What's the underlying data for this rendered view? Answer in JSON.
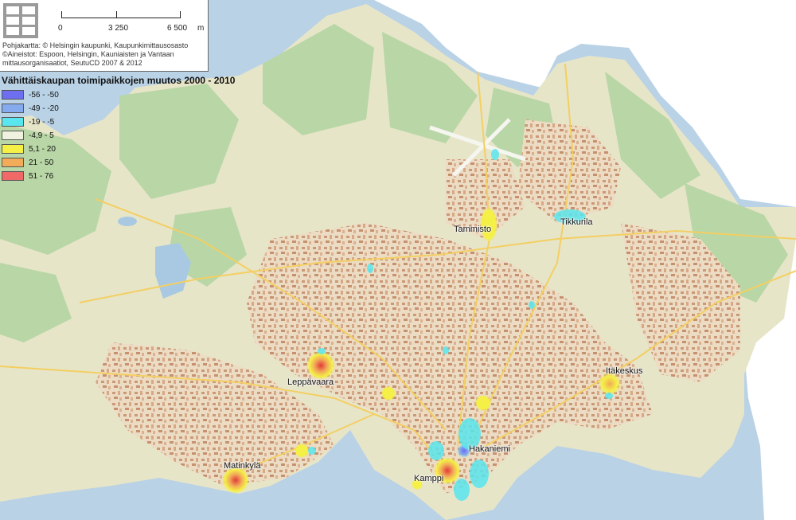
{
  "scale_bar": {
    "labels": [
      "0",
      "3 250",
      "6 500"
    ],
    "unit": "m"
  },
  "credits": [
    "Pohjakartta: © Helsingin kaupunki, Kaupunkimittausosasto",
    "©Aineistot: Espoon, Helsingin, Kauniaisten ja Vantaan",
    "mittausorganisaatiot, SeutuCD 2007 & 2012"
  ],
  "legend": {
    "title": "Vähittäiskaupan toimipaikkojen muutos 2000 - 2010",
    "items": [
      {
        "label": "-56 - -50",
        "color": "#6e6ef0"
      },
      {
        "label": "-49 - -20",
        "color": "#86aaee"
      },
      {
        "label": "-19 - -5",
        "color": "#5ae6ee"
      },
      {
        "label": "-4,9 - 5",
        "color": "#f0f2df"
      },
      {
        "label": "5,1 - 20",
        "color": "#f4f046"
      },
      {
        "label": "21 - 50",
        "color": "#f2ab58"
      },
      {
        "label": "51 - 76",
        "color": "#f06868"
      }
    ]
  },
  "places": [
    {
      "name": "Tammisto"
    },
    {
      "name": "Tikkurila"
    },
    {
      "name": "Leppävaara"
    },
    {
      "name": "Itäkeskus"
    },
    {
      "name": "Hakaniemi"
    },
    {
      "name": "Matinkylä"
    },
    {
      "name": "Kamppi"
    }
  ]
}
